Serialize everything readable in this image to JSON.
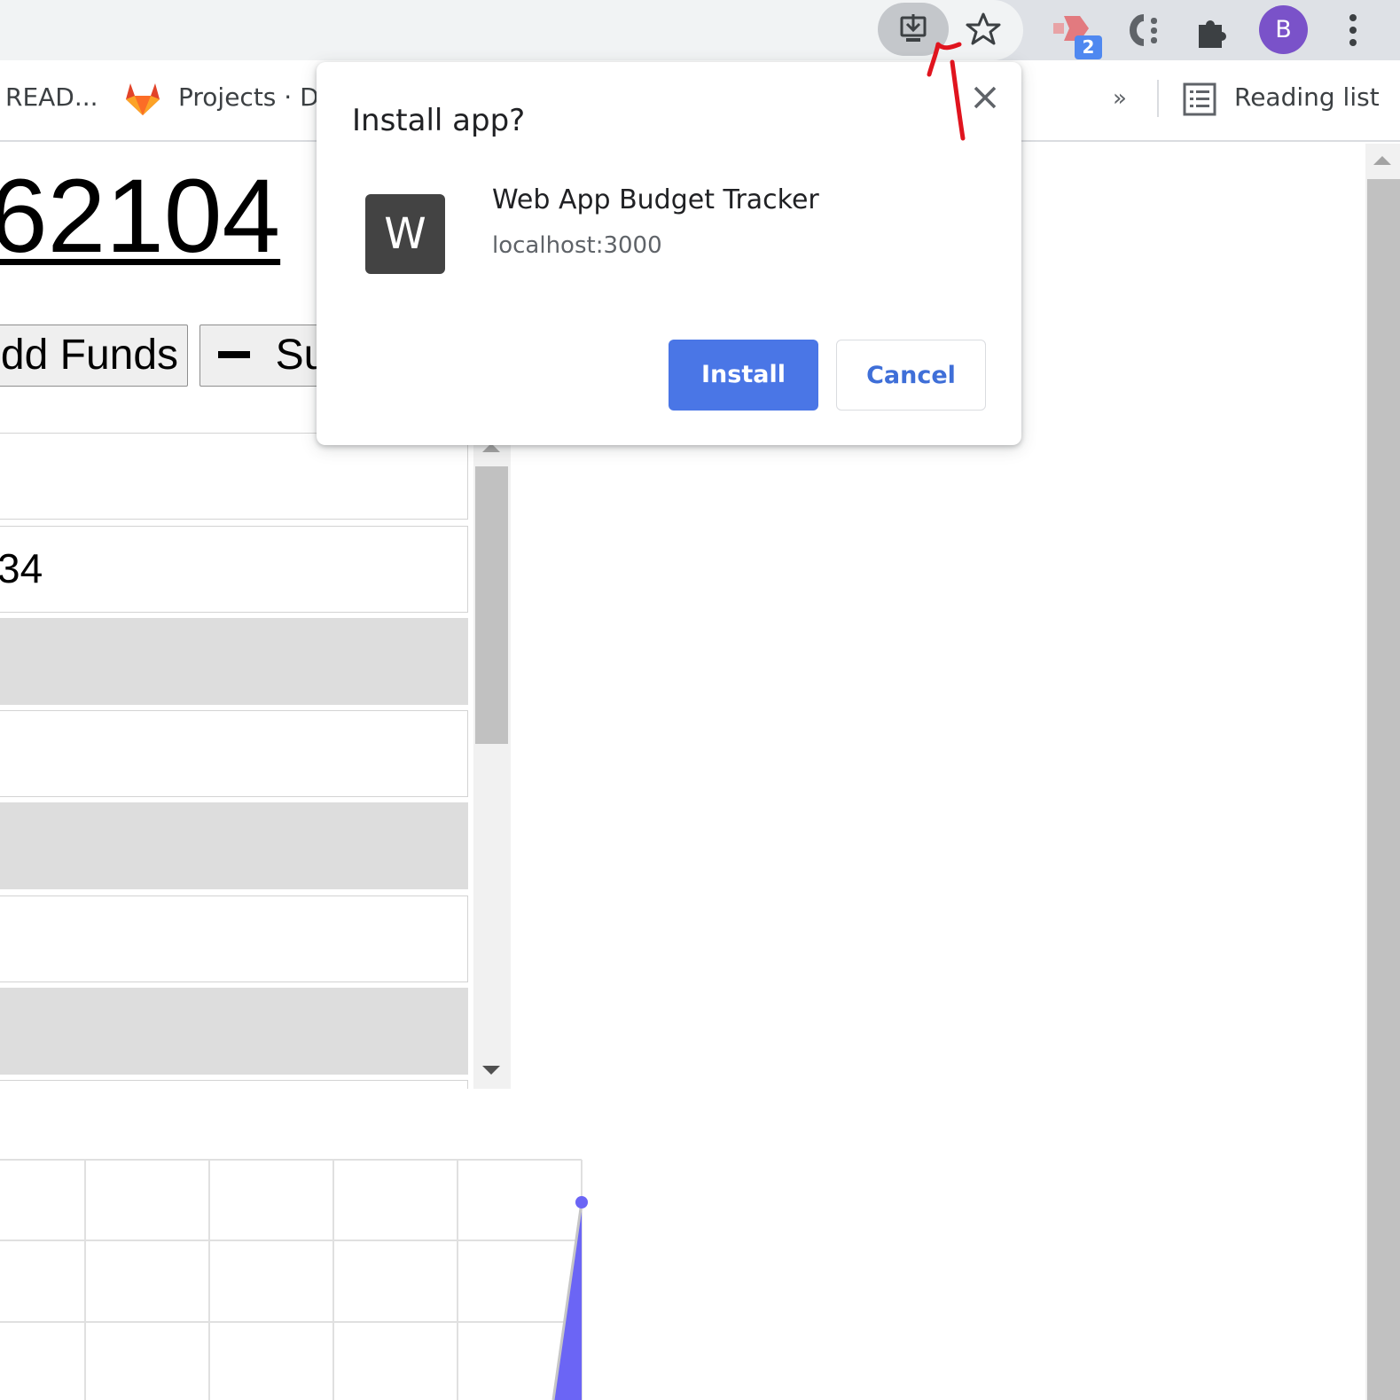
{
  "colors": {
    "accent": "#4a76e6",
    "annotation": "#e0141e",
    "avatar": "#7a52c9",
    "chart_line": "#6b65f5"
  },
  "toolbar": {
    "install_icon": "install-app-icon",
    "bookmark_icon": "star-icon",
    "extension_badge": "2",
    "avatar_initial": "B",
    "menu_icon": "kebab-menu-icon"
  },
  "bookmarks": {
    "items": [
      {
        "label": "READ..."
      },
      {
        "label": "Projects · Da"
      }
    ],
    "overflow": "»",
    "reading_list": "Reading list"
  },
  "page": {
    "balance": "62104",
    "add_funds_label": "dd Funds",
    "subtract_label": "Su",
    "rows": [
      {
        "text": ""
      },
      {
        "text": "34"
      },
      {
        "text": ""
      },
      {
        "text": ""
      },
      {
        "text": ""
      },
      {
        "text": ""
      },
      {
        "text": ""
      }
    ]
  },
  "dialog": {
    "title": "Install app?",
    "app_icon_letter": "W",
    "app_name": "Web App Budget Tracker",
    "app_origin": "localhost:3000",
    "install_label": "Install",
    "cancel_label": "Cancel"
  }
}
